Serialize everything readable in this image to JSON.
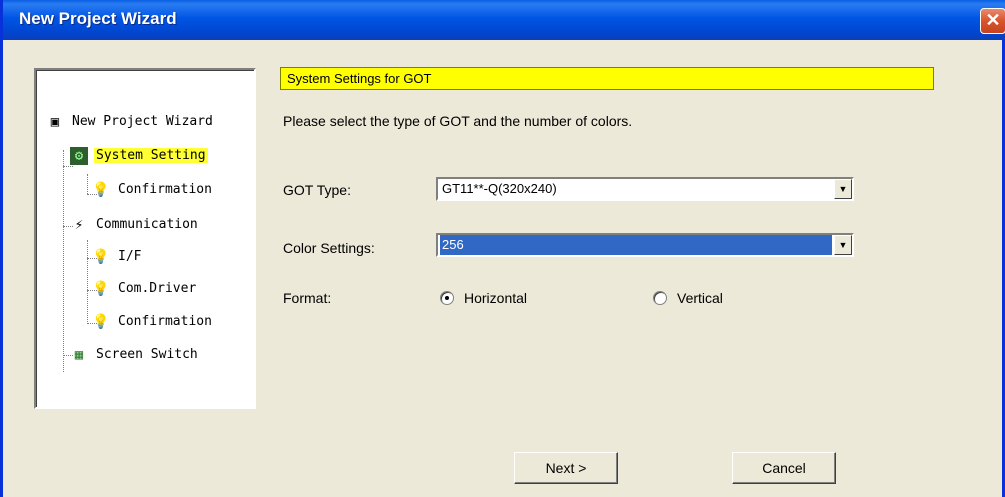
{
  "window": {
    "title": "New Project Wizard",
    "close_symbol": "✕"
  },
  "tree": {
    "items": [
      {
        "label": "New Project Wizard",
        "icon": "wizard-icon"
      },
      {
        "label": "System Setting",
        "icon": "system-setting-icon",
        "selected": true
      },
      {
        "label": "Confirmation",
        "icon": "bulb-icon"
      },
      {
        "label": "Communication",
        "icon": "communication-icon"
      },
      {
        "label": "I/F",
        "icon": "bulb-icon"
      },
      {
        "label": "Com.Driver",
        "icon": "bulb-icon"
      },
      {
        "label": "Confirmation",
        "icon": "bulb-icon"
      },
      {
        "label": "Screen Switch",
        "icon": "screen-switch-icon"
      }
    ]
  },
  "header": "System Settings for GOT",
  "instruction": "Please select the type of GOT and the number of colors.",
  "got_type": {
    "label": "GOT Type:",
    "value": "GT11**-Q(320x240)"
  },
  "color_settings": {
    "label": "Color Settings:",
    "value": "256"
  },
  "format": {
    "label": "Format:",
    "options": [
      "Horizontal",
      "Vertical"
    ],
    "selected": "Horizontal"
  },
  "buttons": {
    "next": "Next >",
    "cancel": "Cancel"
  }
}
